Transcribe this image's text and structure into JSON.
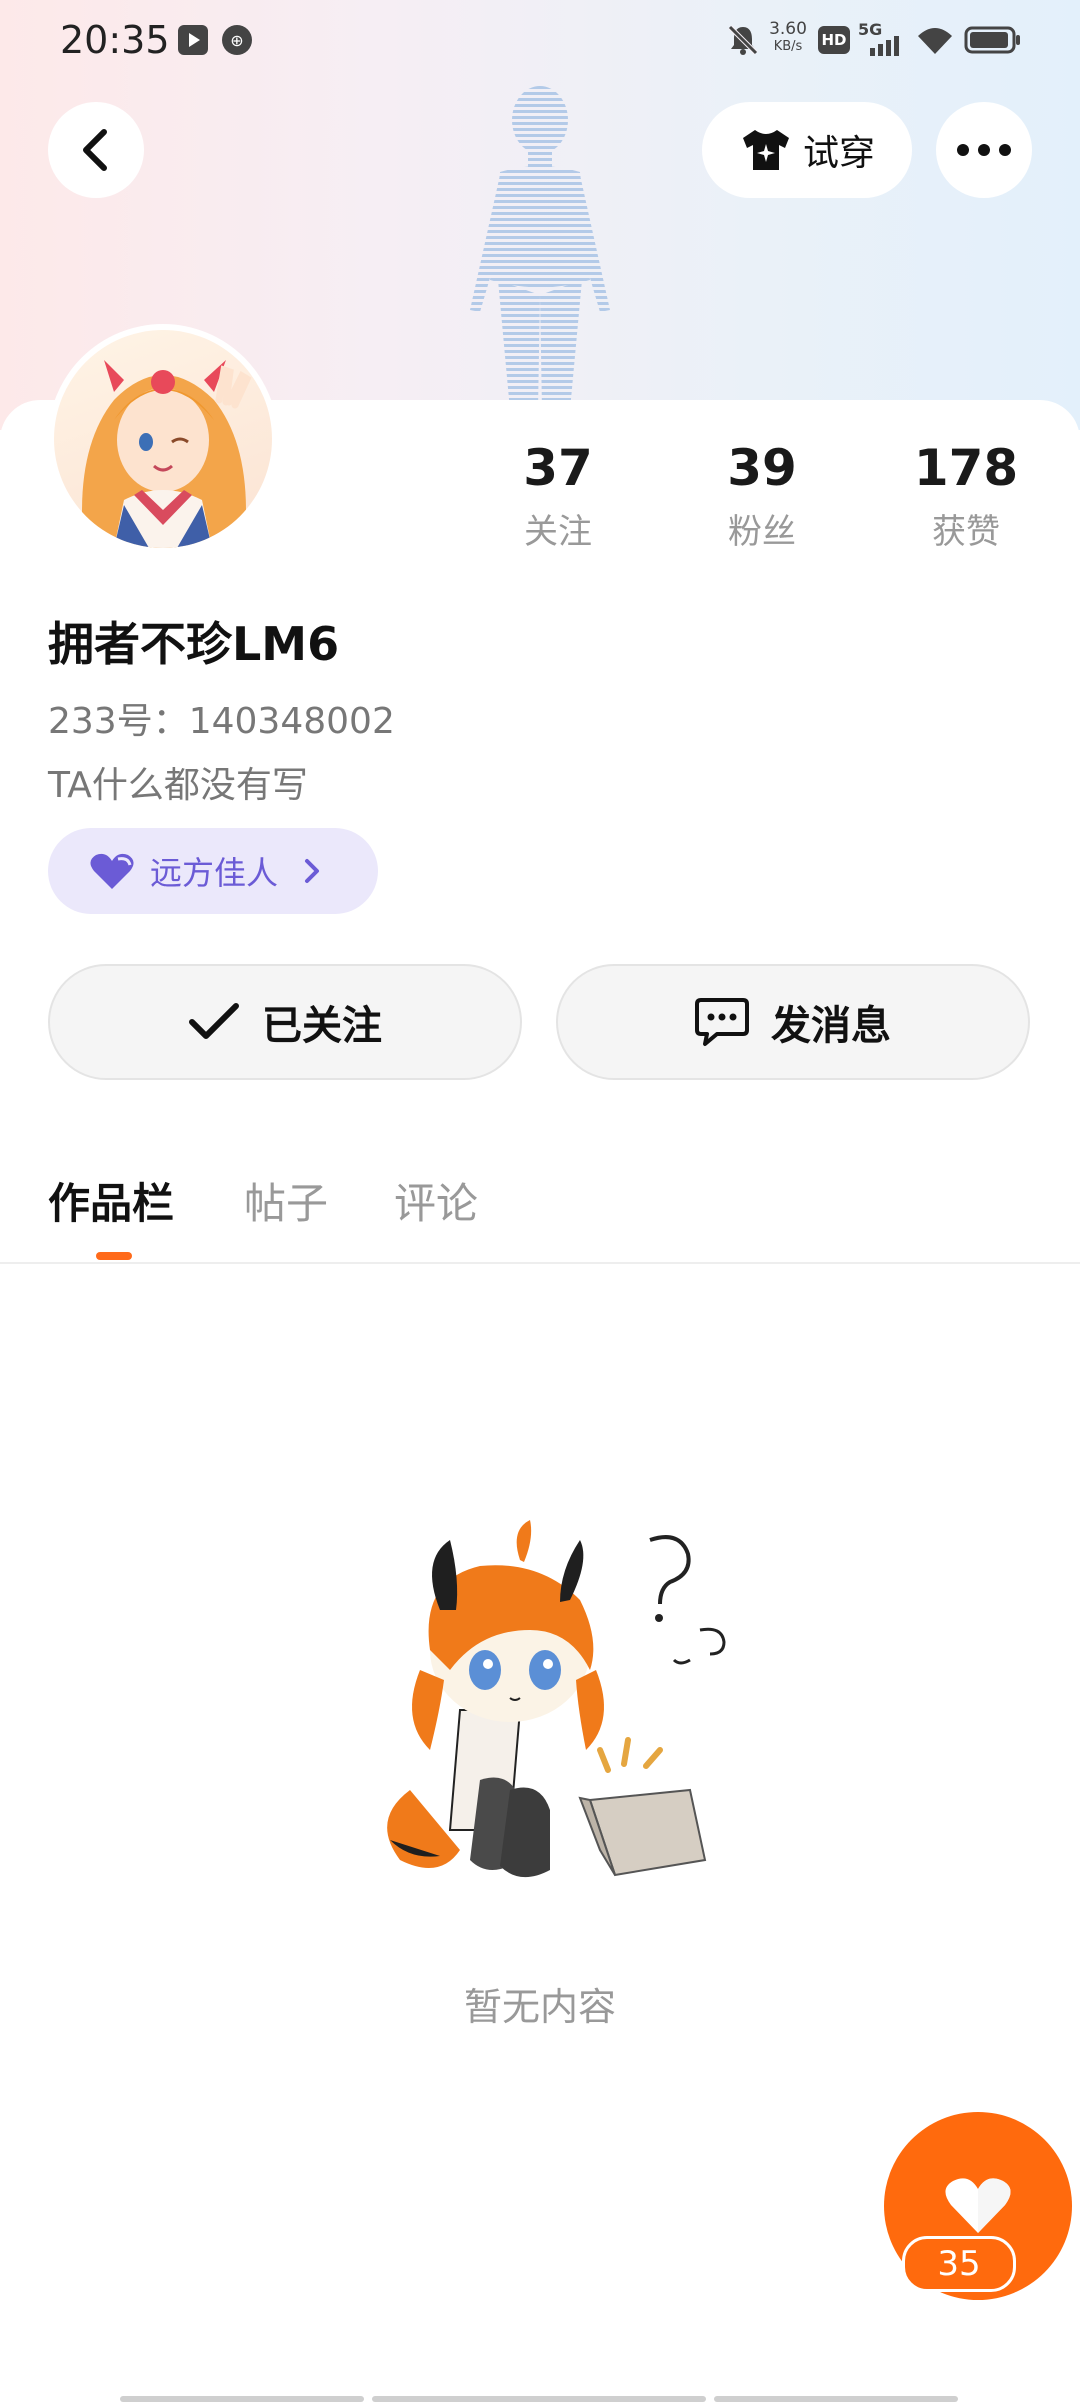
{
  "status_bar": {
    "time": "20:35",
    "net_speed_value": "3.60",
    "net_speed_unit": "KB/s",
    "hd": "HD",
    "network": "5G"
  },
  "header": {
    "try_on_label": "试穿",
    "back_icon": "chevron-left-icon",
    "more_icon": "more-dots-icon"
  },
  "profile": {
    "username": "拥者不珍LM6",
    "uid": "233号：140348002",
    "bio": "TA什么都没有写",
    "badge_label": "远方佳人",
    "stats": [
      {
        "value": "37",
        "label": "关注"
      },
      {
        "value": "39",
        "label": "粉丝"
      },
      {
        "value": "178",
        "label": "获赞"
      }
    ]
  },
  "actions": {
    "following_label": "已关注",
    "message_label": "发消息"
  },
  "tabs": [
    {
      "label": "作品栏",
      "active": true
    },
    {
      "label": "帖子",
      "active": false
    },
    {
      "label": "评论",
      "active": false
    }
  ],
  "empty_state": {
    "text": "暂无内容"
  },
  "fab": {
    "count": "35"
  },
  "colors": {
    "accent": "#ff6a0d",
    "badge_bg": "#ebe8fb",
    "badge_text": "#6b5bd6"
  }
}
